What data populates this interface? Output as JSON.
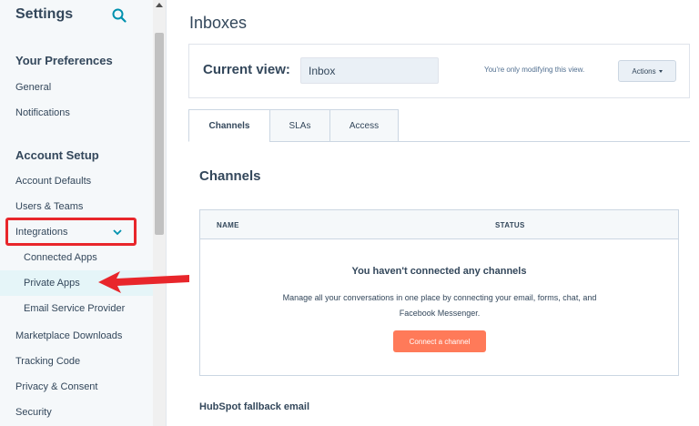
{
  "sidebar": {
    "title": "Settings",
    "search_icon": "search-icon",
    "sections": {
      "preferences": "Your Preferences",
      "account_setup": "Account Setup"
    },
    "items": {
      "general": "General",
      "notifications": "Notifications",
      "account_defaults": "Account Defaults",
      "users_teams": "Users & Teams",
      "integrations": "Integrations",
      "connected_apps": "Connected Apps",
      "private_apps": "Private Apps",
      "email_service_provider": "Email Service Provider",
      "marketplace_downloads": "Marketplace Downloads",
      "tracking_code": "Tracking Code",
      "privacy_consent": "Privacy & Consent",
      "security": "Security"
    }
  },
  "main": {
    "title": "Inboxes",
    "current_view_label": "Current view:",
    "current_view_value": "Inbox",
    "view_note": "You're only modifying this view.",
    "actions_label": "Actions",
    "tabs": [
      {
        "label": "Channels"
      },
      {
        "label": "SLAs"
      },
      {
        "label": "Access"
      }
    ],
    "section_heading": "Channels",
    "table": {
      "columns": [
        "NAME",
        "STATUS"
      ],
      "empty_title": "You haven't connected any channels",
      "empty_desc": "Manage all your conversations in one place by connecting your email, forms, chat, and Facebook Messenger.",
      "connect_button": "Connect a channel"
    },
    "fallback_heading": "HubSpot fallback email"
  },
  "colors": {
    "accent": "#ff7a59",
    "highlight": "#e8262b",
    "active_item_bg": "#e5f5f8"
  }
}
